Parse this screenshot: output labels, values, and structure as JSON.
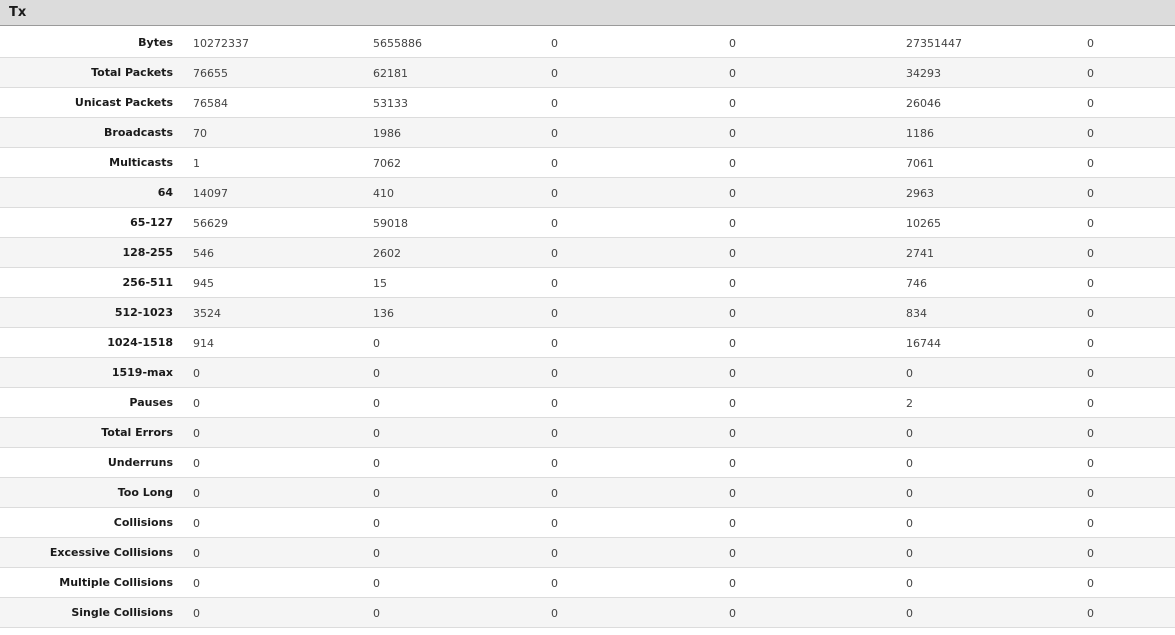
{
  "section": {
    "title": "Tx"
  },
  "rows": [
    {
      "label": "Bytes",
      "values": [
        "10272337",
        "5655886",
        "0",
        "0",
        "27351447",
        "0"
      ]
    },
    {
      "label": "Total Packets",
      "values": [
        "76655",
        "62181",
        "0",
        "0",
        "34293",
        "0"
      ]
    },
    {
      "label": "Unicast Packets",
      "values": [
        "76584",
        "53133",
        "0",
        "0",
        "26046",
        "0"
      ]
    },
    {
      "label": "Broadcasts",
      "values": [
        "70",
        "1986",
        "0",
        "0",
        "1186",
        "0"
      ]
    },
    {
      "label": "Multicasts",
      "values": [
        "1",
        "7062",
        "0",
        "0",
        "7061",
        "0"
      ]
    },
    {
      "label": "64",
      "values": [
        "14097",
        "410",
        "0",
        "0",
        "2963",
        "0"
      ]
    },
    {
      "label": "65-127",
      "values": [
        "56629",
        "59018",
        "0",
        "0",
        "10265",
        "0"
      ]
    },
    {
      "label": "128-255",
      "values": [
        "546",
        "2602",
        "0",
        "0",
        "2741",
        "0"
      ]
    },
    {
      "label": "256-511",
      "values": [
        "945",
        "15",
        "0",
        "0",
        "746",
        "0"
      ]
    },
    {
      "label": "512-1023",
      "values": [
        "3524",
        "136",
        "0",
        "0",
        "834",
        "0"
      ]
    },
    {
      "label": "1024-1518",
      "values": [
        "914",
        "0",
        "0",
        "0",
        "16744",
        "0"
      ]
    },
    {
      "label": "1519-max",
      "values": [
        "0",
        "0",
        "0",
        "0",
        "0",
        "0"
      ]
    },
    {
      "label": "Pauses",
      "values": [
        "0",
        "0",
        "0",
        "0",
        "2",
        "0"
      ]
    },
    {
      "label": "Total Errors",
      "values": [
        "0",
        "0",
        "0",
        "0",
        "0",
        "0"
      ]
    },
    {
      "label": "Underruns",
      "values": [
        "0",
        "0",
        "0",
        "0",
        "0",
        "0"
      ]
    },
    {
      "label": "Too Long",
      "values": [
        "0",
        "0",
        "0",
        "0",
        "0",
        "0"
      ]
    },
    {
      "label": "Collisions",
      "values": [
        "0",
        "0",
        "0",
        "0",
        "0",
        "0"
      ]
    },
    {
      "label": "Excessive Collisions",
      "values": [
        "0",
        "0",
        "0",
        "0",
        "0",
        "0"
      ]
    },
    {
      "label": "Multiple Collisions",
      "values": [
        "0",
        "0",
        "0",
        "0",
        "0",
        "0"
      ]
    },
    {
      "label": "Single Collisions",
      "values": [
        "0",
        "0",
        "0",
        "0",
        "0",
        "0"
      ]
    }
  ]
}
